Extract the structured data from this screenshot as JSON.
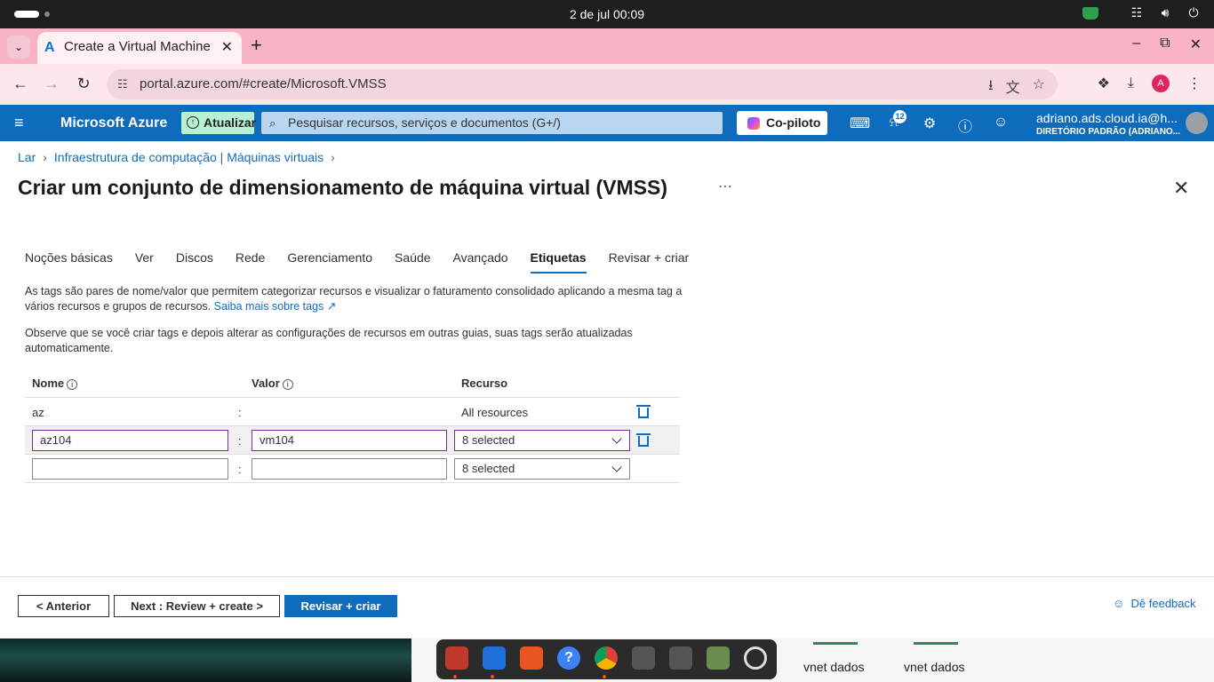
{
  "os": {
    "clock": "2 de jul  00:09"
  },
  "browser": {
    "tab_title": "Create a Virtual Machine",
    "url": "portal.azure.com/#create/Microsoft.VMSS",
    "profile_initial": "A"
  },
  "azure": {
    "brand": "Microsoft Azure",
    "update_label": "Atualizar",
    "search_placeholder": "Pesquisar recursos, serviços e documentos (G+/)",
    "copilot_label": "Co-piloto",
    "notifications_count": "12",
    "user_email": "adriano.ads.cloud.ia@h...",
    "user_directory": "DIRETÓRIO PADRÃO (ADRIANO..."
  },
  "breadcrumb": [
    "Lar",
    "Infraestrutura de computação | Máquinas virtuais"
  ],
  "page_title": "Criar um conjunto de dimensionamento de máquina virtual (VMSS)",
  "tabs": [
    "Noções básicas",
    "Ver",
    "Discos",
    "Rede",
    "Gerenciamento",
    "Saúde",
    "Avançado",
    "Etiquetas",
    "Revisar + criar"
  ],
  "active_tab": "Etiquetas",
  "description": {
    "p1": "As tags são pares de nome/valor que permitem categorizar recursos e visualizar o faturamento consolidado aplicando a mesma tag a vários recursos e grupos de recursos.",
    "p1_link": "Saiba mais sobre tags",
    "p2": "Observe que se você criar tags e depois alterar as configurações de recursos em outras guias, suas tags serão atualizadas automaticamente."
  },
  "table": {
    "headers": {
      "name": "Nome",
      "value": "Valor",
      "resource": "Recurso"
    },
    "rows": [
      {
        "name": "az",
        "value": "",
        "resource": "All resources"
      },
      {
        "name": "az104",
        "value": "vm104",
        "resource": "8 selected"
      },
      {
        "name": "",
        "value": "",
        "resource": "8 selected"
      }
    ]
  },
  "footer": {
    "prev": "< Anterior",
    "next": "Next : Review + create >",
    "review": "Revisar + criar",
    "feedback": "Dê feedback"
  },
  "desktop": {
    "labels": [
      "vnet dados",
      "vnet dados"
    ]
  }
}
